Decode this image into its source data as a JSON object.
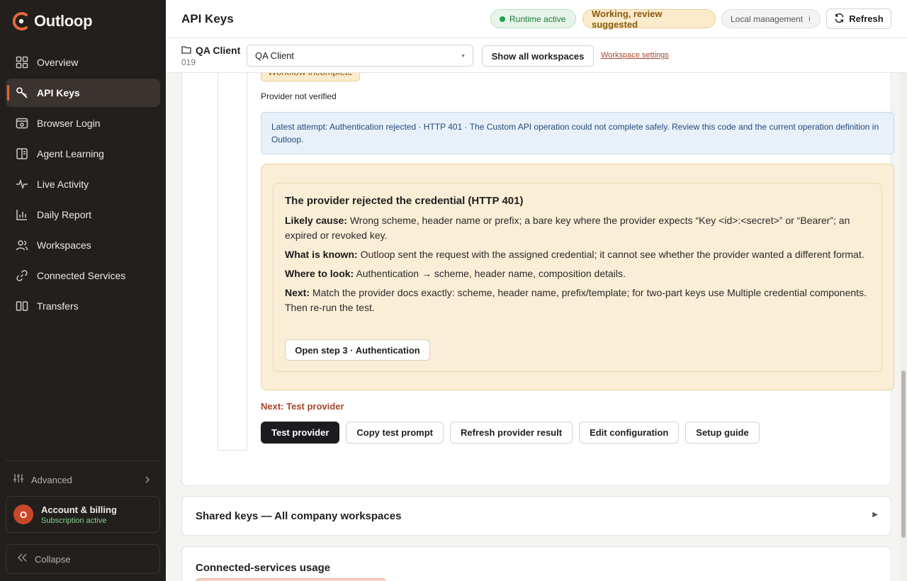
{
  "app": {
    "name": "Outloop"
  },
  "sidebar": {
    "items": [
      {
        "label": "Overview",
        "icon": "grid-icon"
      },
      {
        "label": "API Keys",
        "icon": "key-icon",
        "active": true
      },
      {
        "label": "Browser Login",
        "icon": "browser-icon"
      },
      {
        "label": "Agent Learning",
        "icon": "book-icon"
      },
      {
        "label": "Live Activity",
        "icon": "pulse-icon"
      },
      {
        "label": "Daily Report",
        "icon": "bar-chart-icon"
      },
      {
        "label": "Workspaces",
        "icon": "users-icon"
      },
      {
        "label": "Connected Services",
        "icon": "link-icon"
      },
      {
        "label": "Transfers",
        "icon": "columns-icon"
      }
    ],
    "advanced": "Advanced",
    "account": {
      "initial": "O",
      "title": "Account & billing",
      "status": "Subscription active"
    },
    "collapse": "Collapse",
    "accent_color": "#e2683a"
  },
  "topbar": {
    "title": "API Keys",
    "runtime_status": "Runtime active",
    "review_status": "Working, review suggested",
    "management": "Local management",
    "info_glyph": "i",
    "refresh_label": "Refresh"
  },
  "workspace": {
    "name": "QA Client",
    "number": "019",
    "selected": "QA Client",
    "show_all_label": "Show all workspaces",
    "settings_link": "Workspace settings"
  },
  "provider": {
    "workflow_badge": "Workflow incomplete",
    "verification": "Provider not verified",
    "latest_attempt": "Latest attempt: Authentication rejected · HTTP 401 · The Custom API operation could not complete safely. Review this code and the current operation definition in Outloop.",
    "diagnosis": {
      "title": "The provider rejected the credential (HTTP 401)",
      "likely_cause_label": "Likely cause:",
      "likely_cause": "Wrong scheme, header name or prefix; a bare key where the provider expects “Key <id>:<secret>” or “Bearer”; an expired or revoked key.",
      "known_label": "What is known:",
      "known": "Outloop sent the request with the assigned credential; it cannot see whether the provider wanted a different format.",
      "where_label": "Where to look:",
      "where": "Authentication → scheme, header name, composition details.",
      "next_label": "Next:",
      "next": "Match the provider docs exactly: scheme, header name, prefix/template; for two-part keys use Multiple credential components. Then re-run the test.",
      "open_step_label": "Open step 3 · Authentication"
    },
    "next_step": "Next: Test provider",
    "actions": {
      "test": "Test provider",
      "copy_prompt": "Copy test prompt",
      "refresh_result": "Refresh provider result",
      "edit": "Edit configuration",
      "guide": "Setup guide"
    }
  },
  "sections": {
    "shared_keys": "Shared keys — All company workspaces",
    "usage": "Connected-services usage"
  }
}
